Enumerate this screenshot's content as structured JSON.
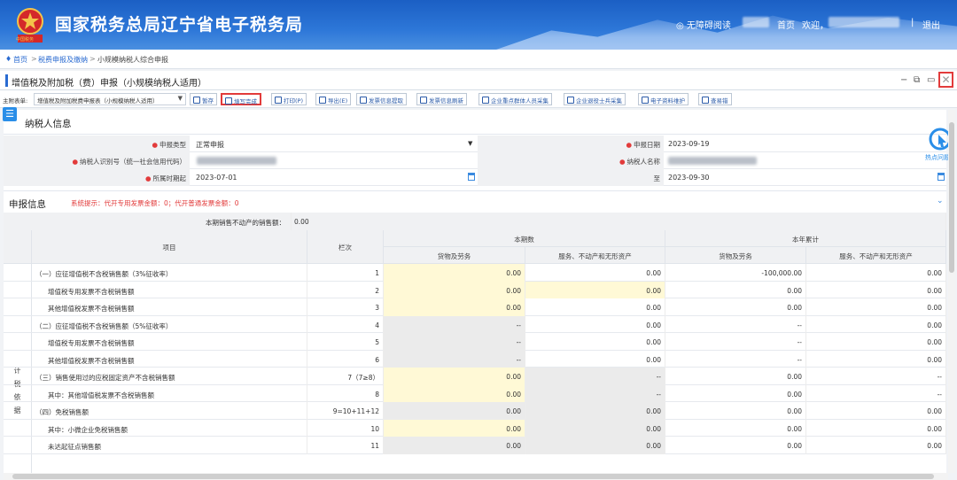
{
  "header": {
    "site_title": "国家税务总局辽宁省电子税务局",
    "accessibility": "◎ 无障碍阅读",
    "home": "首页",
    "welcome": "欢迎，",
    "logout": "退出",
    "emblem_caption": "中国税务",
    "colors": {
      "bar": "#2d77d8",
      "title": "#ffffff"
    }
  },
  "breadcrumb": {
    "pin_icon": "location-pin-icon",
    "items": [
      "首页",
      "税费申报及缴纳",
      "小规模纳税人综合申报"
    ],
    "separator": ">"
  },
  "tab": {
    "title": "增值税及附加税（费）申报（小规模纳税人适用）"
  },
  "toolbar": {
    "main_table_label": "主附表单:",
    "main_table_value": "增值税及附加税费申报表（小规模纳税人适用）",
    "buttons": [
      {
        "label": "暂存",
        "icon": "save-icon"
      },
      {
        "label": "填写完成",
        "icon": "complete-icon"
      },
      {
        "label": "打印(P)",
        "icon": "print-icon"
      },
      {
        "label": "导出(E)",
        "icon": "export-icon"
      },
      {
        "label": "发票信息提取",
        "icon": "invoice-extract-icon"
      },
      {
        "label": "发票信息刷新",
        "icon": "refresh-icon"
      },
      {
        "label": "企业重点群体人员采集",
        "icon": "group-collect-icon"
      },
      {
        "label": "企业退役士兵采集",
        "icon": "veteran-collect-icon"
      },
      {
        "label": "电子资料维护",
        "icon": "edit-doc-icon"
      },
      {
        "label": "查易错",
        "icon": "search-icon"
      }
    ]
  },
  "side": {
    "menu_icon": "☰",
    "hotspot_label": "热点问题"
  },
  "taxpayer": {
    "section_title": "纳税人信息",
    "declaration_type_label": "申报类型",
    "declaration_type_value": "正常申报",
    "declaration_date_label": "申报日期",
    "declaration_date_value": "2023-09-19",
    "tax_id_label": "纳税人识别号（统一社会信用代码）",
    "taxpayer_name_label": "纳税人名称",
    "period_label": "所属时期起",
    "period_start": "2023-07-01",
    "period_end_label": "至",
    "period_end": "2023-09-30"
  },
  "declaration": {
    "section_title": "申报信息",
    "system_notice": "系统提示：代开专用发票金额：0；代开普通发票金额：0",
    "real_estate_label": "本期销售不动产的销售额：",
    "real_estate_value": "0.00",
    "headers": {
      "item": "项目",
      "line_no": "栏次",
      "current_period": "本期数",
      "year_total": "本年累计",
      "goods": "货物及劳务",
      "services": "服务、不动产和无形资产"
    },
    "vertical_label": [
      "计",
      "税",
      "依",
      "据"
    ],
    "rows": [
      {
        "item": "（一）应征增值税不含税销售额（3%征收率）",
        "indent": false,
        "line": "1",
        "a": "0.00",
        "b": "0.00",
        "c": "-100,000.00",
        "d": "0.00",
        "ca": "yel",
        "cb": "",
        "cc": "",
        "cd": ""
      },
      {
        "item": "增值税专用发票不含税销售额",
        "indent": true,
        "line": "2",
        "a": "0.00",
        "b": "0.00",
        "c": "0.00",
        "d": "0.00",
        "ca": "yel",
        "cb": "yel",
        "cc": "",
        "cd": ""
      },
      {
        "item": "其他增值税发票不含税销售额",
        "indent": true,
        "line": "3",
        "a": "0.00",
        "b": "0.00",
        "c": "0.00",
        "d": "0.00",
        "ca": "yel",
        "cb": "",
        "cc": "",
        "cd": ""
      },
      {
        "item": "（二）应征增值税不含税销售额（5%征收率）",
        "indent": false,
        "line": "4",
        "a": "--",
        "b": "0.00",
        "c": "--",
        "d": "0.00",
        "ca": "gry",
        "cb": "",
        "cc": "",
        "cd": ""
      },
      {
        "item": "增值税专用发票不含税销售额",
        "indent": true,
        "line": "5",
        "a": "--",
        "b": "0.00",
        "c": "--",
        "d": "0.00",
        "ca": "gry",
        "cb": "",
        "cc": "",
        "cd": ""
      },
      {
        "item": "其他增值税发票不含税销售额",
        "indent": true,
        "line": "6",
        "a": "--",
        "b": "0.00",
        "c": "--",
        "d": "0.00",
        "ca": "gry",
        "cb": "",
        "cc": "",
        "cd": ""
      },
      {
        "item": "（三）销售使用过的应税固定资产不含税销售额",
        "indent": false,
        "line": "7（7≥8）",
        "a": "0.00",
        "b": "--",
        "c": "0.00",
        "d": "--",
        "ca": "yel",
        "cb": "gry",
        "cc": "",
        "cd": ""
      },
      {
        "item": "其中：其他增值税发票不含税销售额",
        "indent": true,
        "line": "8",
        "a": "0.00",
        "b": "--",
        "c": "0.00",
        "d": "--",
        "ca": "yel",
        "cb": "gry",
        "cc": "",
        "cd": ""
      },
      {
        "item": "（四）免税销售额",
        "indent": false,
        "line": "9=10+11+12",
        "a": "0.00",
        "b": "0.00",
        "c": "0.00",
        "d": "0.00",
        "ca": "gry",
        "cb": "gry",
        "cc": "",
        "cd": ""
      },
      {
        "item": "其中：小微企业免税销售额",
        "indent": true,
        "line": "10",
        "a": "0.00",
        "b": "0.00",
        "c": "0.00",
        "d": "0.00",
        "ca": "yel",
        "cb": "gry",
        "cc": "",
        "cd": ""
      },
      {
        "item": "未达起征点销售额",
        "indent": true,
        "line": "11",
        "a": "0.00",
        "b": "0.00",
        "c": "0.00",
        "d": "0.00",
        "ca": "gry",
        "cb": "gry",
        "cc": "",
        "cd": ""
      }
    ]
  }
}
